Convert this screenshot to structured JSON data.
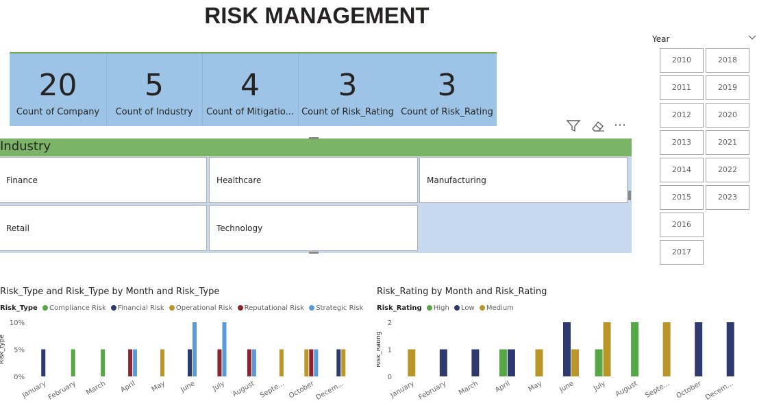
{
  "page": {
    "title": "RISK MANAGEMENT"
  },
  "kpis": [
    {
      "value": "20",
      "label": "Count of Company"
    },
    {
      "value": "5",
      "label": "Count of Industry"
    },
    {
      "value": "4",
      "label": "Count of Mitigatio..."
    },
    {
      "value": "3",
      "label": "Count of Risk_Rating"
    },
    {
      "value": "3",
      "label": "Count of Risk_Rating"
    }
  ],
  "toolbar": {
    "filter_icon": "filter-icon",
    "eraser_icon": "eraser-icon",
    "more_icon": "more-options-icon",
    "more_glyph": "⋯"
  },
  "industry": {
    "header": "Industry",
    "items": [
      "Finance",
      "Healthcare",
      "Manufacturing",
      "Retail",
      "Technology"
    ]
  },
  "year_slicer": {
    "header": "Year",
    "years": [
      "2010",
      "2011",
      "2012",
      "2013",
      "2014",
      "2015",
      "2016",
      "2017",
      "2018",
      "2019",
      "2020",
      "2021",
      "2022",
      "2023"
    ]
  },
  "colors": {
    "kpi_bg": "#9dc3e6",
    "industry_header": "#7cb467",
    "compliance": "#56a745",
    "financial": "#2e3a6e",
    "operational": "#b8962a",
    "reputational": "#8b2532",
    "strategic": "#5b9bd5",
    "high": "#56a745",
    "low": "#2e3a6e",
    "medium": "#b8962a"
  },
  "chart_data": [
    {
      "type": "bar",
      "title": "Risk_Type and Risk_Type by Month and Risk_Type",
      "legend_title": "Risk_Type",
      "ylabel": "Risk_type",
      "ylim": [
        0,
        10
      ],
      "yticks": [
        "0%",
        "5%",
        "10%"
      ],
      "categories": [
        "January",
        "February",
        "March",
        "April",
        "May",
        "June",
        "July",
        "August",
        "Septe...",
        "October",
        "Decem..."
      ],
      "series": [
        {
          "name": "Compliance Risk",
          "values": [
            0,
            5,
            5,
            0,
            0,
            0,
            0,
            0,
            0,
            0,
            0
          ]
        },
        {
          "name": "Financial Risk",
          "values": [
            5,
            0,
            0,
            0,
            0,
            5,
            0,
            0,
            0,
            0,
            5
          ]
        },
        {
          "name": "Operational Risk",
          "values": [
            0,
            0,
            0,
            0,
            5,
            0,
            0,
            0,
            5,
            5,
            5
          ]
        },
        {
          "name": "Reputational Risk",
          "values": [
            0,
            0,
            0,
            5,
            0,
            0,
            5,
            5,
            0,
            5,
            0
          ]
        },
        {
          "name": "Strategic Risk",
          "values": [
            0,
            0,
            0,
            5,
            0,
            10,
            10,
            5,
            0,
            5,
            0
          ]
        }
      ]
    },
    {
      "type": "bar",
      "title": "Risk_Rating by Month and Risk_Rating",
      "legend_title": "Risk_Rating",
      "ylabel": "Risk_Rating",
      "ylim": [
        0,
        2
      ],
      "yticks": [
        "0",
        "1",
        "2"
      ],
      "categories": [
        "January",
        "February",
        "March",
        "April",
        "May",
        "June",
        "July",
        "August",
        "Septe...",
        "October",
        "Decem..."
      ],
      "series": [
        {
          "name": "High",
          "values": [
            0,
            0,
            0,
            1,
            0,
            0,
            1,
            2,
            0,
            0,
            0
          ]
        },
        {
          "name": "Low",
          "values": [
            0,
            1,
            1,
            1,
            0,
            2,
            0,
            0,
            0,
            2,
            2
          ]
        },
        {
          "name": "Medium",
          "values": [
            1,
            0,
            0,
            0,
            1,
            1,
            2,
            0,
            2,
            0,
            0
          ]
        }
      ]
    }
  ]
}
